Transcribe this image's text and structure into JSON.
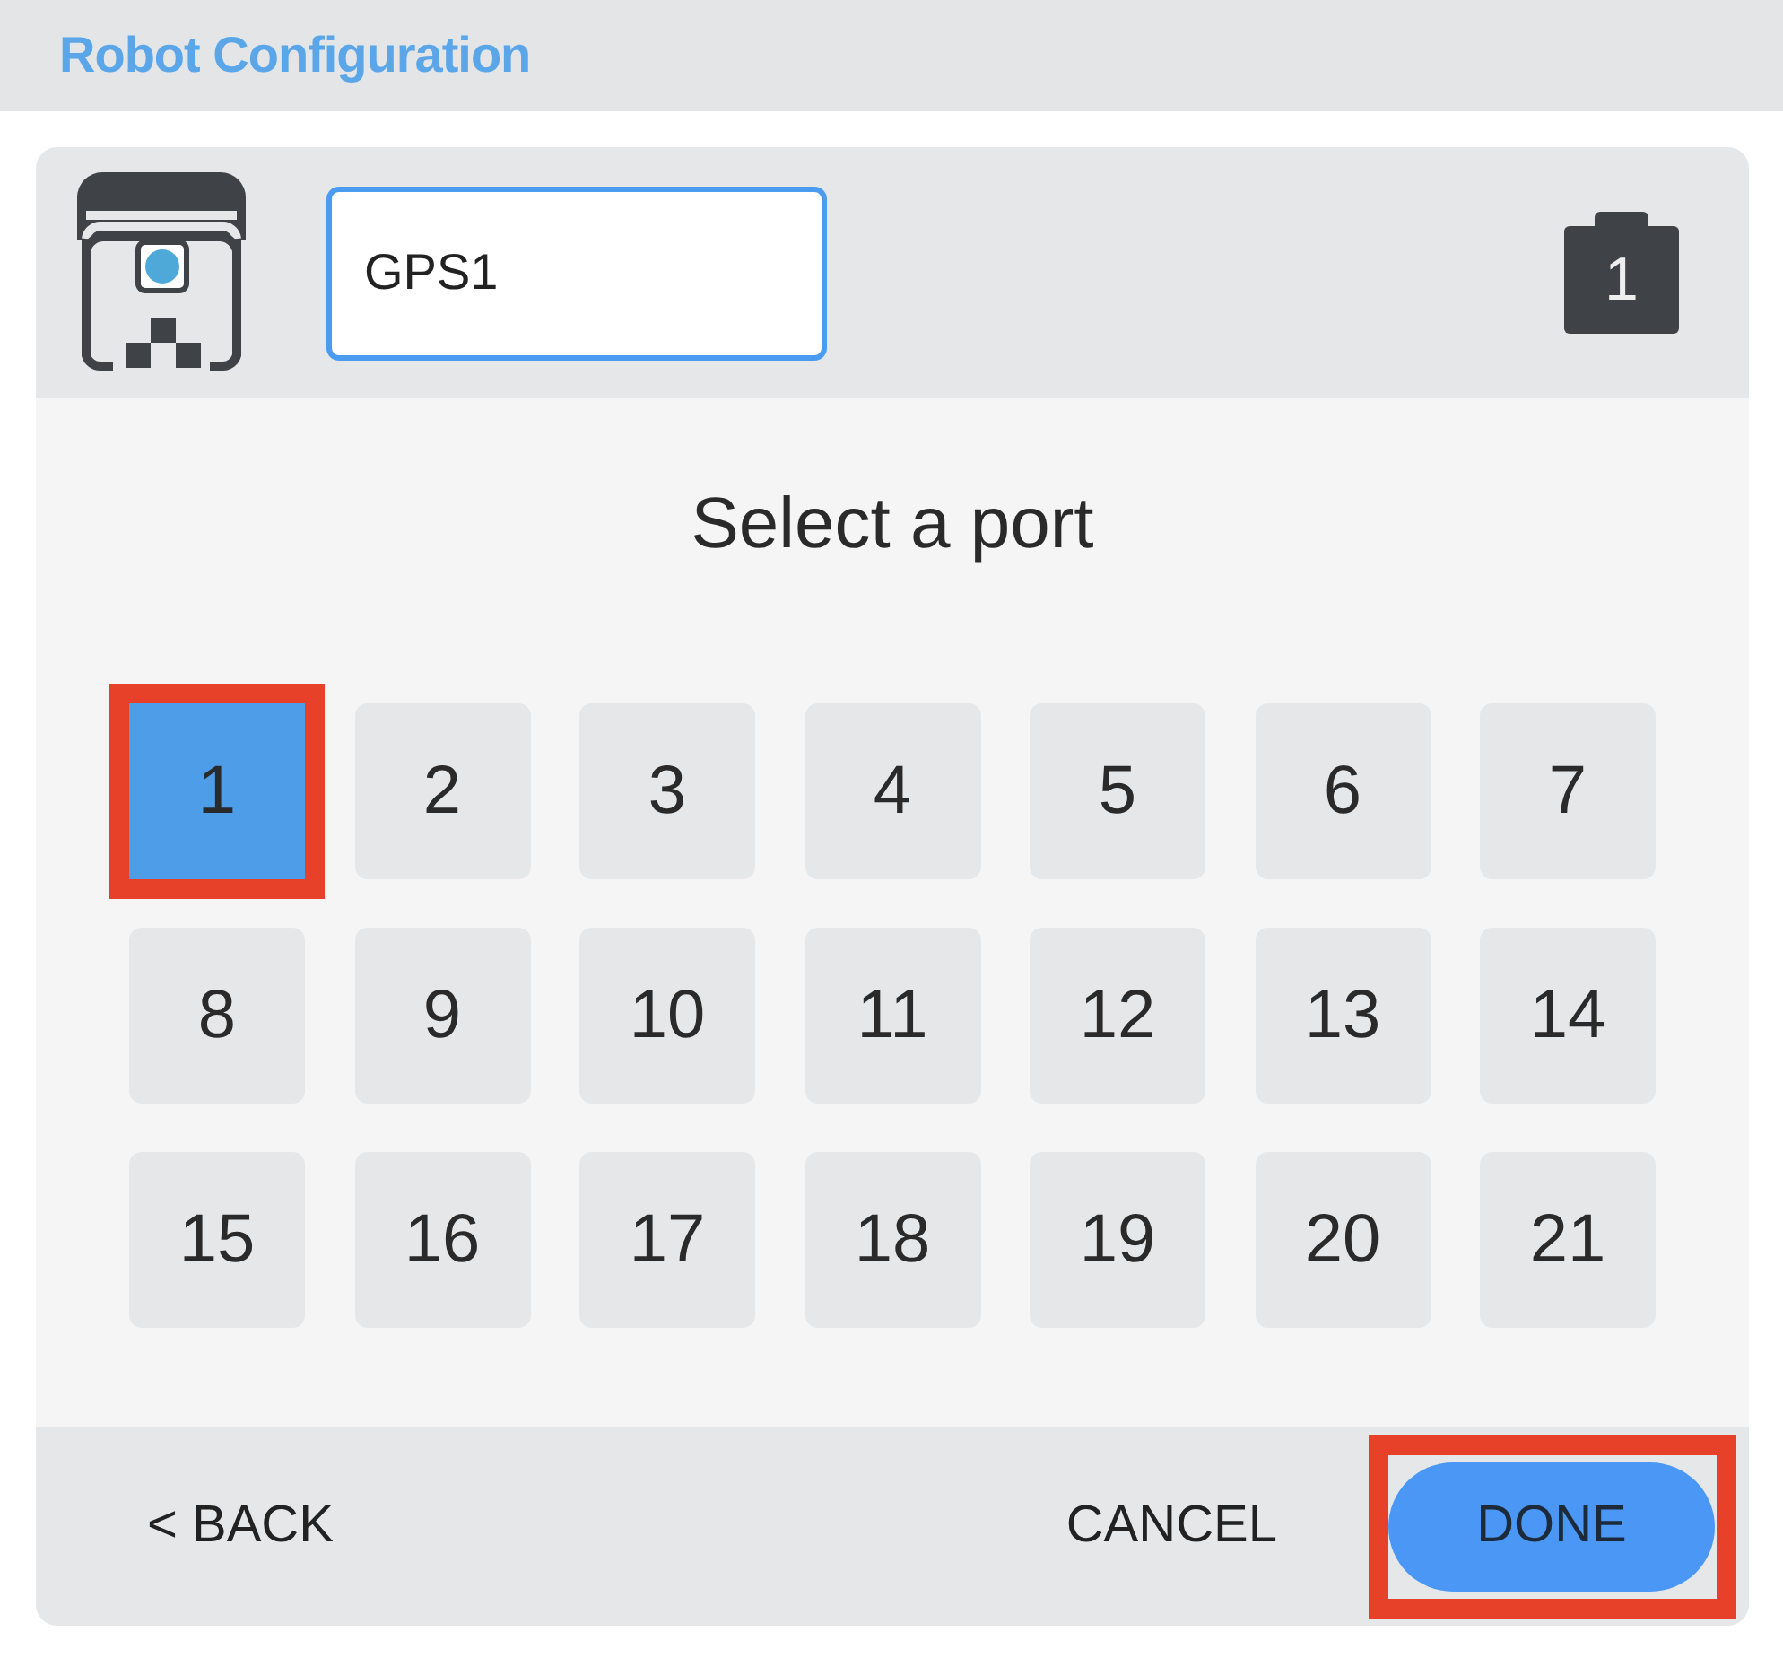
{
  "window": {
    "title": "Robot Configuration"
  },
  "device": {
    "name": "GPS1",
    "port_badge": "1"
  },
  "prompt": "Select a port",
  "ports": [
    {
      "label": "1",
      "selected": true,
      "highlighted": true
    },
    {
      "label": "2",
      "selected": false,
      "highlighted": false
    },
    {
      "label": "3",
      "selected": false,
      "highlighted": false
    },
    {
      "label": "4",
      "selected": false,
      "highlighted": false
    },
    {
      "label": "5",
      "selected": false,
      "highlighted": false
    },
    {
      "label": "6",
      "selected": false,
      "highlighted": false
    },
    {
      "label": "7",
      "selected": false,
      "highlighted": false
    },
    {
      "label": "8",
      "selected": false,
      "highlighted": false
    },
    {
      "label": "9",
      "selected": false,
      "highlighted": false
    },
    {
      "label": "10",
      "selected": false,
      "highlighted": false
    },
    {
      "label": "11",
      "selected": false,
      "highlighted": false
    },
    {
      "label": "12",
      "selected": false,
      "highlighted": false
    },
    {
      "label": "13",
      "selected": false,
      "highlighted": false
    },
    {
      "label": "14",
      "selected": false,
      "highlighted": false
    },
    {
      "label": "15",
      "selected": false,
      "highlighted": false
    },
    {
      "label": "16",
      "selected": false,
      "highlighted": false
    },
    {
      "label": "17",
      "selected": false,
      "highlighted": false
    },
    {
      "label": "18",
      "selected": false,
      "highlighted": false
    },
    {
      "label": "19",
      "selected": false,
      "highlighted": false
    },
    {
      "label": "20",
      "selected": false,
      "highlighted": false
    },
    {
      "label": "21",
      "selected": false,
      "highlighted": false
    }
  ],
  "footer": {
    "back": {
      "label": "< BACK"
    },
    "cancel": {
      "label": "CANCEL"
    },
    "done": {
      "label": "DONE",
      "highlighted": true
    }
  }
}
